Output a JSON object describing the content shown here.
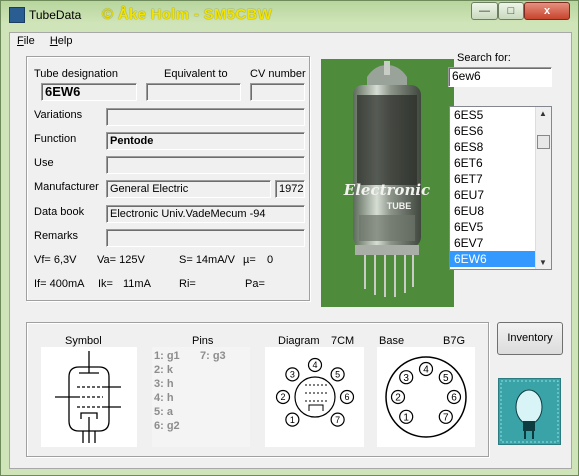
{
  "window": {
    "title": "TubeData",
    "banner": "© Åke Holm - SM5CBW",
    "controls": {
      "minimize": "—",
      "maximize": "□",
      "close": "x"
    }
  },
  "menu": {
    "items": [
      {
        "label": "File"
      },
      {
        "label": "Help"
      }
    ]
  },
  "labels": {
    "tube_designation": "Tube designation",
    "equivalent_to": "Equivalent to",
    "cv_number": "CV number",
    "variations": "Variations",
    "function": "Function",
    "use": "Use",
    "manufacturer": "Manufacturer",
    "data_book": "Data book",
    "remarks": "Remarks",
    "search_for": "Search for:",
    "symbol": "Symbol",
    "pins": "Pins",
    "diagram": "Diagram",
    "diagram_code": "7CM",
    "base": "Base",
    "base_code": "B7G"
  },
  "values": {
    "tube_designation": "6EW6",
    "equivalent_to": "",
    "cv_number": "",
    "variations": "",
    "function": "Pentode",
    "use": "",
    "manufacturer": "General Electric",
    "year": "1972",
    "data_book": "Electronic Univ.VadeMecum -94",
    "remarks": ""
  },
  "params": {
    "vf": "Vf= 6,3V",
    "va": "Va= 125V",
    "s": "S= 14mA/V",
    "mu": "µ=",
    "mu_value": "0",
    "if": "If= 400mA",
    "ik": "Ik=",
    "ik_value": "11mA",
    "ri": "Ri=",
    "pa": "Pa="
  },
  "search": {
    "value": "6ew6"
  },
  "tube_list": {
    "items": [
      "6ES5",
      "6ES6",
      "6ES8",
      "6ET6",
      "6ET7",
      "6EU7",
      "6EU8",
      "6EV5",
      "6EV7",
      "6EW6"
    ],
    "selected": "6EW6"
  },
  "photo_text": {
    "brand": "Electronic",
    "sub": "TUBE"
  },
  "pins": [
    {
      "label": "1: g1"
    },
    {
      "label": "7: g3"
    },
    {
      "label": "2: k"
    },
    {
      "label": "3: h"
    },
    {
      "label": "4: h"
    },
    {
      "label": "5: a"
    },
    {
      "label": "6: g2"
    }
  ],
  "diagram_pins": [
    "1",
    "2",
    "3",
    "4",
    "5",
    "6",
    "7"
  ],
  "inventory_button": "Inventory",
  "colors": {
    "selection": "#3399ff",
    "banner": "#f1e400",
    "chrome": "#cfe4b8"
  }
}
